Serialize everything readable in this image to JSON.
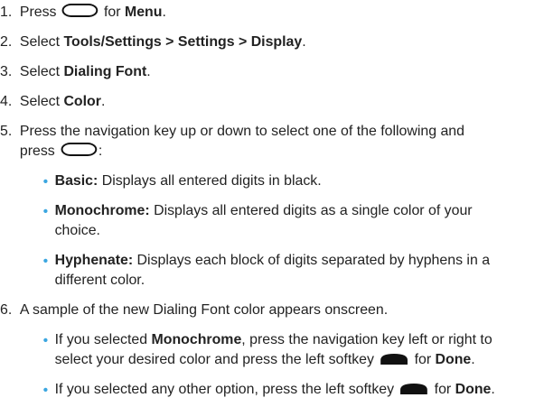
{
  "steps": [
    {
      "num": "1.",
      "a": "Press ",
      "b": " for ",
      "c": "Menu",
      "d": "."
    },
    {
      "num": "2.",
      "a": "Select ",
      "b": "Tools/Settings > Settings > Display",
      "c": "."
    },
    {
      "num": "3.",
      "a": "Select ",
      "b": "Dialing Font",
      "c": "."
    },
    {
      "num": "4.",
      "a": "Select ",
      "b": "Color",
      "c": "."
    },
    {
      "num": "5.",
      "line1": "Press the navigation key up or down to select one of the following and",
      "line2a": "press ",
      "line2b": ":"
    },
    {
      "num": "6.",
      "text": "A sample of the new Dialing Font color appears onscreen."
    }
  ],
  "options": [
    {
      "name": "Basic:",
      "line1": " Displays all entered digits in black."
    },
    {
      "name": "Monochrome:",
      "line1": " Displays all entered digits as a single color of your",
      "line2": "choice."
    },
    {
      "name": "Hyphenate:",
      "line1": " Displays each block of digits separated by hyphens in a",
      "line2": "different color."
    }
  ],
  "step6_sub": [
    {
      "a": "If you selected ",
      "b": "Monochrome",
      "c": ", press the navigation key left or right to",
      "d": "select your desired color and press the left softkey ",
      "e": " for ",
      "f": "Done",
      "g": "."
    },
    {
      "a": "If you selected any other option, press the left softkey ",
      "b": " for ",
      "c": "Done",
      "d": "."
    }
  ],
  "icons": [
    "menu-ok-key-icon",
    "left-softkey-icon"
  ],
  "colors": {
    "bullet": "#3aa6e0",
    "text": "#222222"
  }
}
